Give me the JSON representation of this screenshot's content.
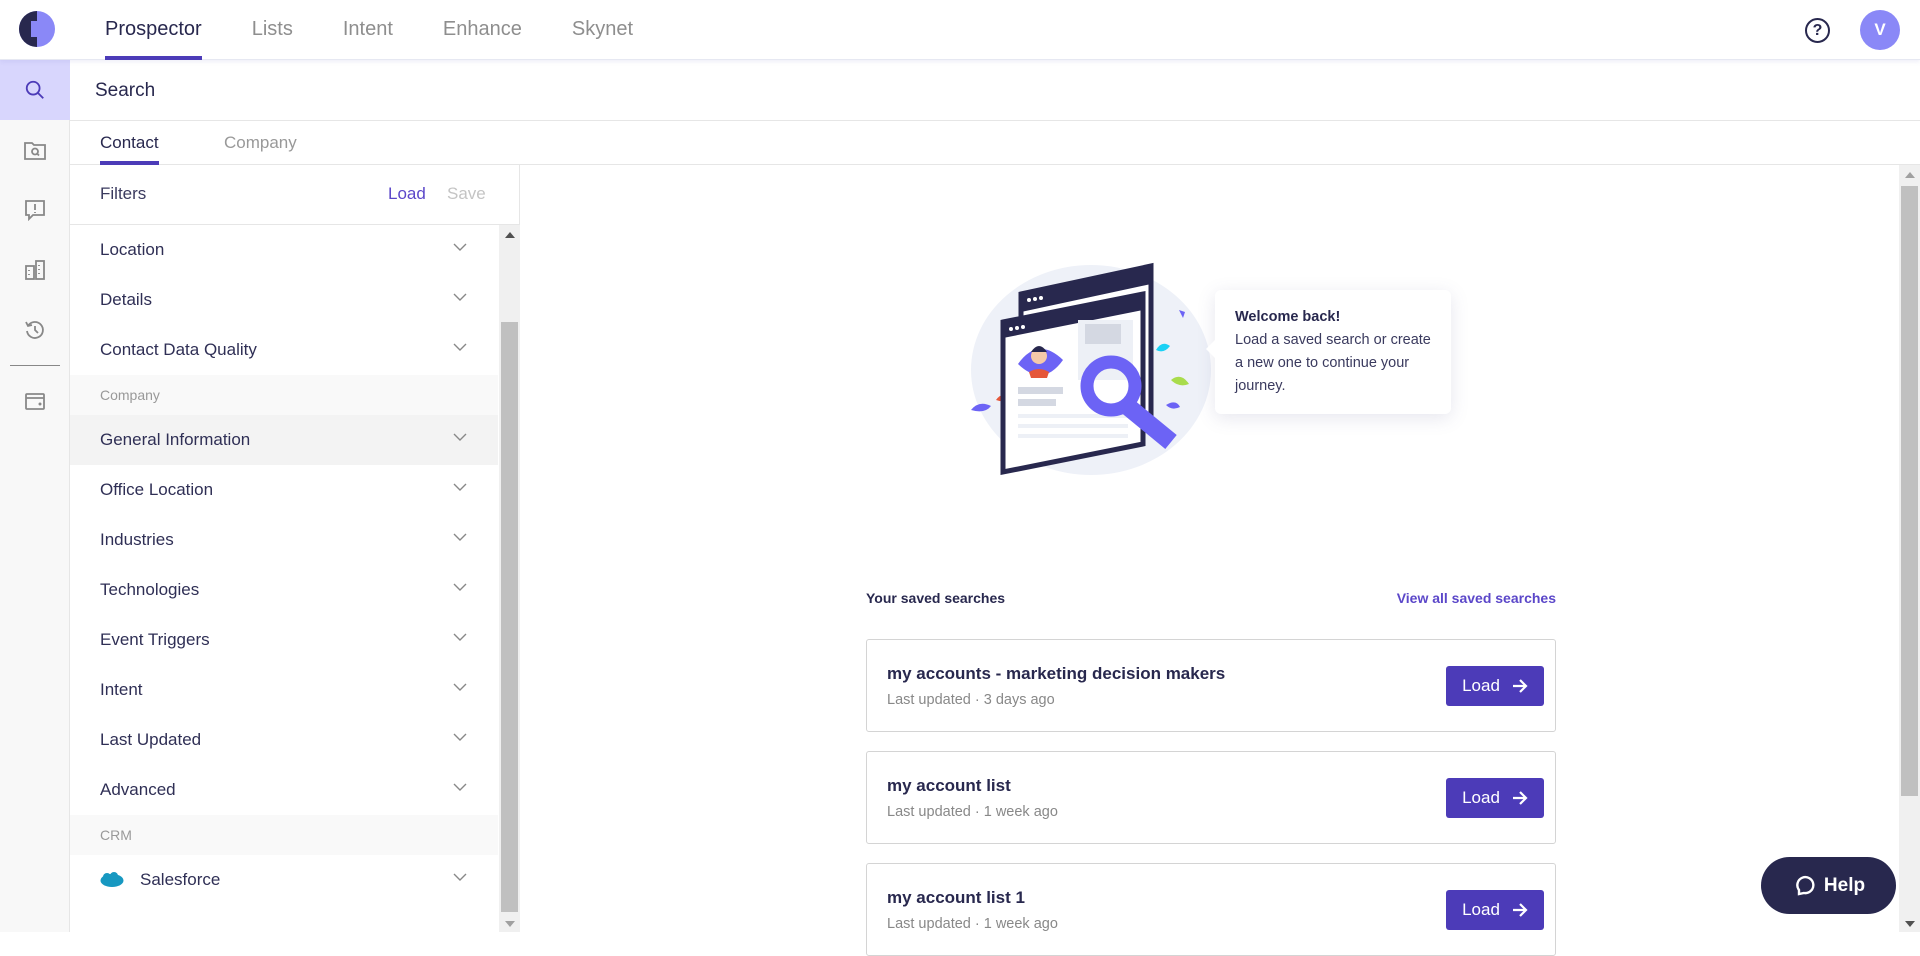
{
  "app": {
    "nav": [
      {
        "label": "Prospector",
        "active": true
      },
      {
        "label": "Lists",
        "active": false
      },
      {
        "label": "Intent",
        "active": false
      },
      {
        "label": "Enhance",
        "active": false
      },
      {
        "label": "Skynet",
        "active": false
      }
    ],
    "help_icon": "question-circle-icon",
    "avatar_initial": "V",
    "accent_color": "#4c3bb8"
  },
  "rail": {
    "items": [
      {
        "icon": "search-icon",
        "active": true
      },
      {
        "icon": "folder-search-icon",
        "active": false
      },
      {
        "icon": "alert-message-icon",
        "active": false
      },
      {
        "icon": "buildings-icon",
        "active": false
      },
      {
        "icon": "history-icon",
        "active": false
      },
      {
        "icon": "wallet-icon",
        "active": false
      }
    ]
  },
  "search": {
    "title": "Search",
    "tabs": [
      {
        "label": "Contact",
        "active": true
      },
      {
        "label": "Company",
        "active": false
      }
    ]
  },
  "filters": {
    "title": "Filters",
    "load_label": "Load",
    "save_label": "Save",
    "contact_items": [
      "Location",
      "Details",
      "Contact Data Quality"
    ],
    "company_section": "Company",
    "company_items": [
      "General Information",
      "Office Location",
      "Industries",
      "Technologies",
      "Event Triggers",
      "Intent",
      "Last Updated",
      "Advanced"
    ],
    "crm_section": "CRM",
    "crm_items": [
      "Salesforce"
    ]
  },
  "welcome": {
    "title": "Welcome back!",
    "body": "Load a saved search or create a new one to continue your journey."
  },
  "saved": {
    "title": "Your saved searches",
    "view_all": "View all saved searches",
    "load_label": "Load",
    "items": [
      {
        "name": "my accounts - marketing decision makers",
        "meta": "Last updated · 3 days ago"
      },
      {
        "name": "my account list",
        "meta": "Last updated · 1 week ago"
      },
      {
        "name": "my account list 1",
        "meta": "Last updated · 1 week ago"
      }
    ]
  },
  "help_button": {
    "label": "Help"
  }
}
